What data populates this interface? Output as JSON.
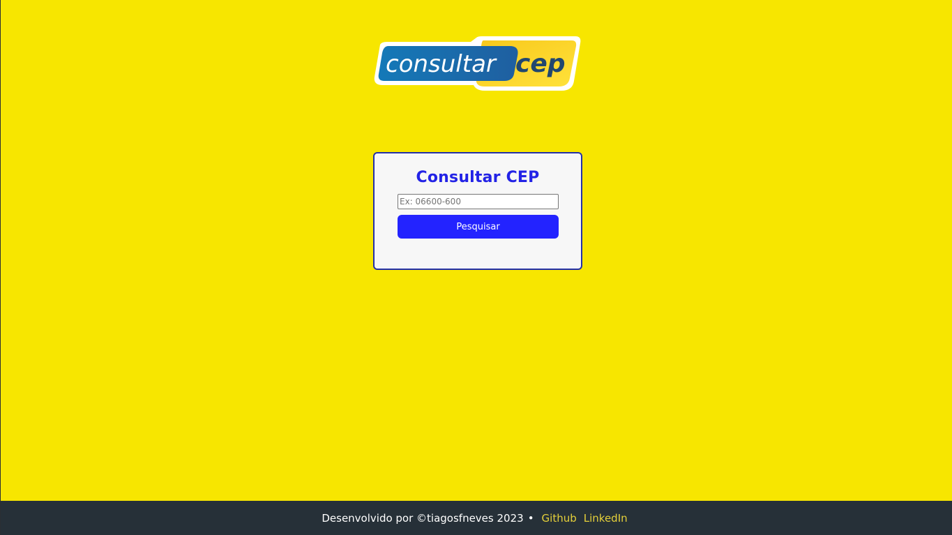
{
  "logo": {
    "text_left": "consultar",
    "text_right": "cep"
  },
  "card": {
    "title": "Consultar CEP",
    "input_placeholder": "Ex: 06600-600",
    "input_value": "",
    "button_label": "Pesquisar"
  },
  "footer": {
    "credit": "Desenvolvido por ©tiagosfneves 2023",
    "separator": "•",
    "links": [
      {
        "label": "Github"
      },
      {
        "label": "LinkedIn"
      }
    ]
  },
  "colors": {
    "background": "#f7e600",
    "card_border": "#2430a8",
    "title": "#2323e6",
    "button": "#2323ff",
    "footer_bg": "#263038",
    "footer_link": "#e5d03a"
  }
}
